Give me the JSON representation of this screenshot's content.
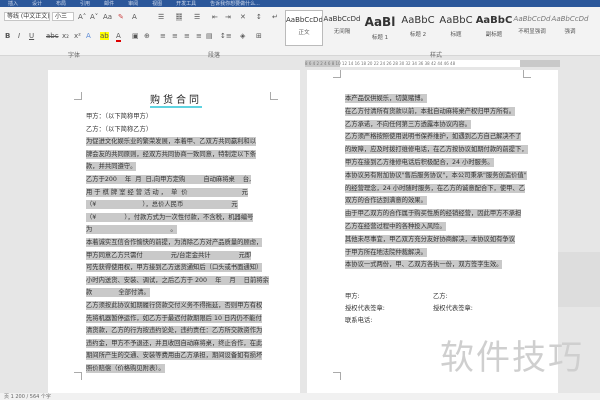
{
  "tabs": [
    "插入",
    "设计",
    "布局",
    "引用",
    "邮件",
    "审阅",
    "视图",
    "开发工具",
    "告诉我你想要做什么..."
  ],
  "font": {
    "name": "等线 (中文正文)",
    "size": "小三",
    "group_label": "字体"
  },
  "paragraph": {
    "group_label": "段落"
  },
  "styles": {
    "group_label": "样式",
    "items": [
      {
        "preview": "AaBbCcDd",
        "name": "正文"
      },
      {
        "preview": "AaBbCcDd",
        "name": "无间隔"
      },
      {
        "preview": "AaBl",
        "name": "标题 1"
      },
      {
        "preview": "AaBbC",
        "name": "标题 2"
      },
      {
        "preview": "AaBbC",
        "name": "标题"
      },
      {
        "preview": "AaBbC",
        "name": "副标题"
      },
      {
        "preview": "AaBbCcDd",
        "name": "不明显强调"
      },
      {
        "preview": "AaBbCcDd",
        "name": "强调"
      }
    ]
  },
  "ruler": "8 6 4 2   2 4 6 8 10 12 14 16 18 20 22 24 26 28 30 32 34 36 38   42 44 46 48",
  "doc": {
    "title": "购货合同",
    "left_lines": [
      {
        "t": "甲方：（以下简称甲方）",
        "h": false
      },
      {
        "t": "乙方：（以下简称乙方）",
        "h": false
      },
      {
        "t": "为促进文化娱乐业的繁荣发展，本着甲、乙双方共同赢利和以",
        "h": true
      },
      {
        "t": "牌会友的共同原则，经双方共同协商一致同意，特制定以下条",
        "h": true
      },
      {
        "t": "款，并共同遵守。",
        "h": true
      },
      {
        "t": "乙方于200    年  月  日,向甲方定购         自动麻将桌    台,",
        "h": true
      },
      {
        "t": "用 于 棋 牌 室 经 营 活 动 ，  单  价                           元",
        "h": true
      },
      {
        "t": "（¥                       ），总价人民币                        元",
        "h": true
      },
      {
        "t": "（¥              ），付款方式为一次性付款，不含税，机器编号",
        "h": true
      },
      {
        "t": "为                                       。",
        "h": true
      },
      {
        "t": "本着诚实互信合作愉快的前提，为消除乙方对产品质量的顾虑，",
        "h": true
      },
      {
        "t": "甲方同意乙方只需付              元/台定金共计              元即",
        "h": true
      },
      {
        "t": "可先获得使用权，甲方接到乙方送货通知后（口头或书面通知）",
        "h": true
      },
      {
        "t": "小时内送货、安装、调试，之后乙方于 200    年    月    日前将余",
        "h": true
      },
      {
        "t": "款             全部付清。",
        "h": true
      },
      {
        "t": "乙方须按此协议如期履行贷款交付义务不得拖延，否则甲方有权",
        "h": true
      },
      {
        "t": "先将机器暂停运作，如乙方于最迟付款期限后 10 日内仍不能付",
        "h": true
      },
      {
        "t": "清货款，乙方的行为按违约论处，违约责任：乙方所交款资作为",
        "h": true
      },
      {
        "t": "违约金，甲方不予退还，并且收回自动麻将桌，终止合作，在此",
        "h": true
      },
      {
        "t": "期间所产生的交通、安装等费用由乙方承担，期间设备如有损坏",
        "h": true
      },
      {
        "t": "照价赔偿（价格购见附表）。",
        "h": true
      }
    ],
    "right_lines": [
      {
        "t": "本产品仅供娱乐，切莫赌博。",
        "h": true
      },
      {
        "t": "在乙方付清所有货款以前，本批自动麻将桌产权归甲方所有。",
        "h": true
      },
      {
        "t": "乙方承诺，不向任何第三方透露本协议内容。",
        "h": true
      },
      {
        "t": "乙方须严格按照使用说明书保养维护，如遇到乙方自己解决不了",
        "h": true
      },
      {
        "t": "的故障，应及时拨打维修电话，在乙方按协议如期付款的前提下，",
        "h": true
      },
      {
        "t": "甲方在接到乙方维修电话后积极配合，24 小时服务。",
        "h": true
      },
      {
        "t": "本协议另有附加协议\"售后服务协议\"，本公司秉承\"服务创造价值\"",
        "h": true
      },
      {
        "t": "的经营理念，24 小时随时服务，在乙方的诚意配合下，使甲、乙",
        "h": true
      },
      {
        "t": "双方的合作达到满意的效果。",
        "h": true
      },
      {
        "t": "由于甲乙双方的合作属于购买性质的经销经营，因此甲方不承担",
        "h": true
      },
      {
        "t": "乙方在经营过程中的各种投入风险。",
        "h": true
      },
      {
        "t": "其他未尽事宜，甲乙双方充分友好协商解决，本协议如有争议",
        "h": true
      },
      {
        "t": "于甲方所在地法院仲裁解决。",
        "h": true
      },
      {
        "t": "本协议一式两份，甲、乙双方各执一份，双方签字生效。",
        "h": true
      }
    ],
    "sign": {
      "party_a": "甲方:",
      "party_b": "乙方:",
      "rep_a": "授权代表签章:",
      "rep_b": "授权代表签章:",
      "phone": "联系电话:"
    }
  },
  "status": "页 1       200 / 564 个字",
  "watermark": "软件技巧"
}
